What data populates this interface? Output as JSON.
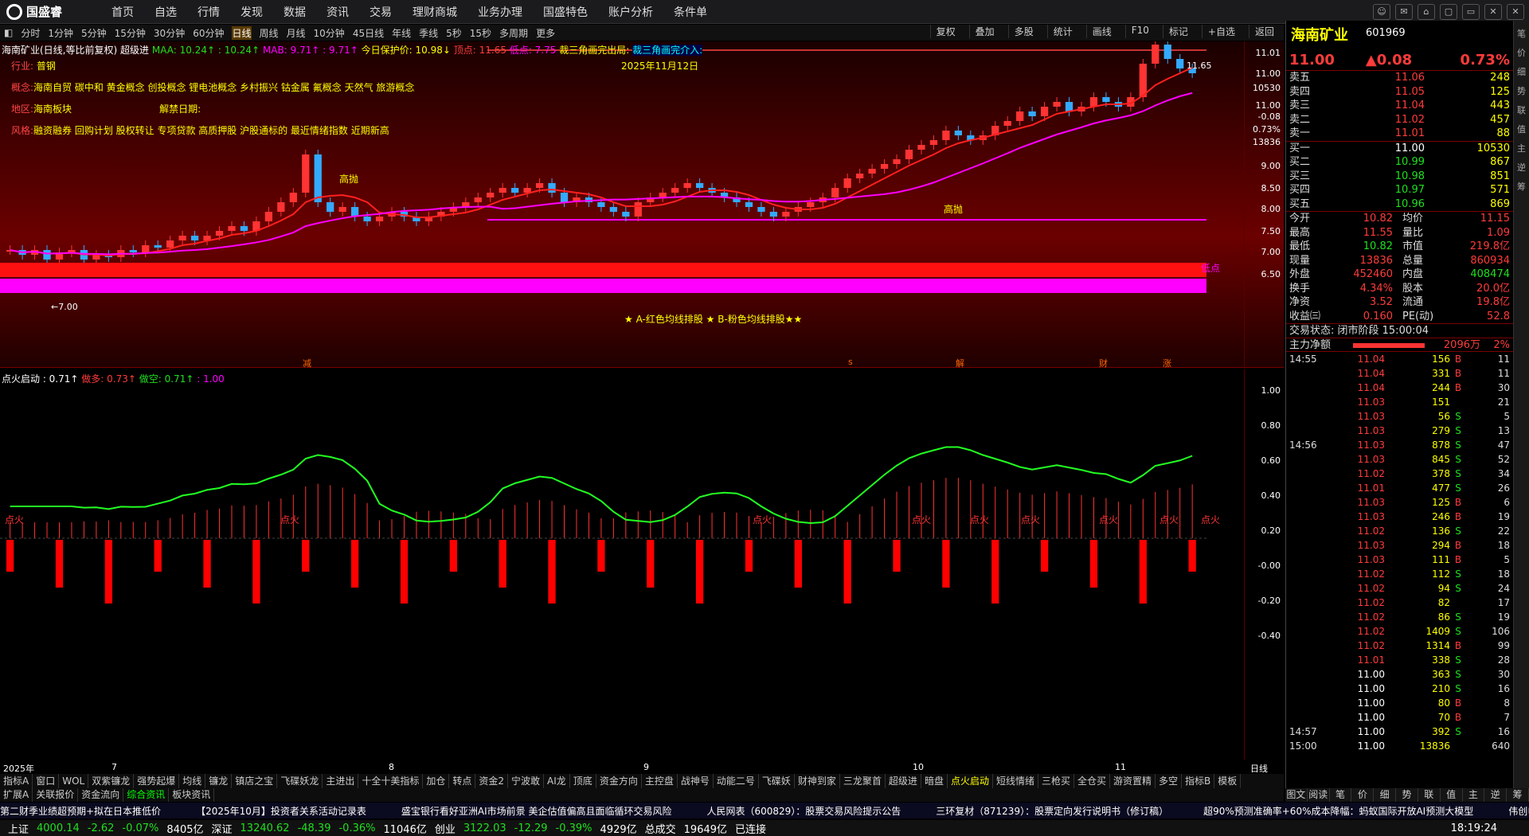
{
  "app": {
    "name": "国盛睿",
    "nav": [
      "首页",
      "自选",
      "行情",
      "发现",
      "数据",
      "资讯",
      "交易",
      "理财商城",
      "业务办理",
      "国盛特色",
      "账户分析",
      "条件单"
    ],
    "window_controls": [
      "☺",
      "✉",
      "⌂",
      "▢",
      "▭",
      "✕",
      "✕"
    ]
  },
  "periods": {
    "items": [
      "分时",
      "1分钟",
      "5分钟",
      "15分钟",
      "30分钟",
      "60分钟",
      "日线",
      "周线",
      "月线",
      "10分钟",
      "45日线",
      "年线",
      "季线",
      "5秒",
      "15秒",
      "多周期",
      "更多"
    ],
    "active": "日线"
  },
  "tools": [
    "复权",
    "叠加",
    "多股",
    "统计",
    "画线",
    "F10",
    "标记",
    "+自选",
    "返回"
  ],
  "main": {
    "title": "海南矿业(日线,等比前复权)",
    "title2": "超级进",
    "maa": "MAA: 10.24↑ : 10.24↑",
    "mab": "MAB: 9.71↑ : 9.71↑",
    "protect": "今日保护价: 10.98↓",
    "high": "顶点: 11.65",
    "low": "低点: 7.75",
    "tri1": "裁三角画完出局:",
    "tri2": "裁三角画完介入:",
    "industry_k": "行业:",
    "industry": "普钢",
    "concept_k": "概念:",
    "concept": "海南自贸 碳中和 黄金概念 创投概念 锂电池概念 乡村振兴 钴金属 氟概念 天然气 旅游概念",
    "region_k": "地区:",
    "region": "海南板块",
    "unlock_k": "解禁日期:",
    "style_k": "风格:",
    "style": "融资融券 回购计划 股权转让 专项贷款 高质押股 沪股通标的 最近情绪指数 近期新高",
    "date_label": "2025年11月12日",
    "label_top": "高抛",
    "label_top2": "高抛",
    "label_low": "低点",
    "label_min": "←7.00",
    "label_max": "11.65",
    "banner": "★ A-红色均线排股 ★ B-粉色均线排股★★",
    "yticks": [
      "11.01",
      "11.00",
      "10530",
      "11.00",
      "-0.08",
      "0.73%",
      "13836",
      "9.00",
      "8.50",
      "8.00",
      "7.50",
      "7.00",
      "6.50"
    ],
    "events": [
      "减",
      "s",
      "解",
      "财",
      "涨"
    ]
  },
  "sub": {
    "title": "点火启动 : 0.71↑",
    "t2": "做多: 0.73↑",
    "t3": "做空: 0.71↑",
    "t4": ": 1.00",
    "fire": "点火",
    "yticks": [
      "1.00",
      "0.80",
      "0.60",
      "0.40",
      "0.20",
      "-0.00",
      "-0.20",
      "-0.40"
    ],
    "xlabels": [
      "2025年",
      "7",
      "8",
      "9",
      "10",
      "11"
    ],
    "xright": "日线"
  },
  "chart_data": {
    "type": "candlestick",
    "title": "海南矿业(日线,等比前复权)",
    "ylim": [
      6.5,
      11.5
    ],
    "max": 11.65,
    "min": 7.0,
    "close": [
      7.3,
      7.2,
      7.3,
      7.1,
      7.25,
      7.3,
      7.1,
      7.2,
      7.15,
      7.3,
      7.25,
      7.4,
      7.35,
      7.5,
      7.6,
      7.5,
      7.6,
      7.7,
      7.8,
      7.7,
      7.9,
      8.1,
      8.3,
      8.5,
      9.3,
      8.3,
      8.1,
      8.2,
      8.0,
      7.9,
      8.0,
      8.1,
      8.0,
      7.9,
      8.0,
      8.1,
      8.2,
      8.3,
      8.4,
      8.5,
      8.6,
      8.5,
      8.6,
      8.7,
      8.5,
      8.3,
      8.4,
      8.3,
      8.2,
      8.1,
      8.0,
      8.3,
      8.4,
      8.5,
      8.6,
      8.7,
      8.6,
      8.5,
      8.4,
      8.3,
      8.2,
      8.1,
      8.0,
      8.1,
      8.2,
      8.3,
      8.4,
      8.6,
      8.8,
      8.9,
      9.0,
      9.1,
      9.2,
      9.4,
      9.5,
      9.6,
      9.8,
      9.7,
      9.6,
      9.7,
      9.9,
      10.0,
      10.2,
      10.1,
      10.3,
      10.4,
      10.2,
      10.3,
      10.5,
      10.4,
      10.3,
      10.5,
      11.2,
      11.6,
      11.3,
      11.1,
      11.0
    ]
  },
  "panel": {
    "name": "海南矿业",
    "code": "601969",
    "price": "11.00",
    "chg": "▲0.08",
    "pct": "0.73%",
    "asks": [
      [
        "卖五",
        "11.06",
        "248"
      ],
      [
        "卖四",
        "11.05",
        "125"
      ],
      [
        "卖三",
        "11.04",
        "443"
      ],
      [
        "卖二",
        "11.02",
        "457"
      ],
      [
        "卖一",
        "11.01",
        "88"
      ]
    ],
    "bids": [
      [
        "买一",
        "11.00",
        "10530"
      ],
      [
        "买二",
        "10.99",
        "867"
      ],
      [
        "买三",
        "10.98",
        "851"
      ],
      [
        "买四",
        "10.97",
        "571"
      ],
      [
        "买五",
        "10.96",
        "869"
      ]
    ],
    "stats": [
      [
        "今开",
        "10.82",
        "均价",
        "11.15"
      ],
      [
        "最高",
        "11.55",
        "量比",
        "1.09"
      ],
      [
        "最低",
        "10.82",
        "市值",
        "219.8亿"
      ],
      [
        "现量",
        "13836",
        "总量",
        "860934"
      ],
      [
        "外盘",
        "452460",
        "内盘",
        "408474"
      ],
      [
        "换手",
        "4.34%",
        "股本",
        "20.0亿"
      ],
      [
        "净资",
        "3.52",
        "流通",
        "19.8亿"
      ],
      [
        "收益㈢",
        "0.160",
        "PE(动)",
        "52.8"
      ]
    ],
    "trade_state": "交易状态: 闭市阶段 15:00:04",
    "main_net_k": "主力净额",
    "main_net": "2096万",
    "main_pct": "2%",
    "ticks": [
      [
        "14:55",
        "11.04",
        "156",
        "B",
        "11"
      ],
      [
        "",
        "11.04",
        "331",
        "B",
        "11"
      ],
      [
        "",
        "11.04",
        "244",
        "B",
        "30"
      ],
      [
        "",
        "11.03",
        "151",
        "",
        "21"
      ],
      [
        "",
        "11.03",
        "56",
        "S",
        "5"
      ],
      [
        "",
        "11.03",
        "279",
        "S",
        "13"
      ],
      [
        "14:56",
        "11.03",
        "878",
        "S",
        "47"
      ],
      [
        "",
        "11.03",
        "845",
        "S",
        "52"
      ],
      [
        "",
        "11.02",
        "378",
        "S",
        "34"
      ],
      [
        "",
        "11.01",
        "477",
        "S",
        "26"
      ],
      [
        "",
        "11.03",
        "125",
        "B",
        "6"
      ],
      [
        "",
        "11.03",
        "246",
        "B",
        "19"
      ],
      [
        "",
        "11.02",
        "136",
        "S",
        "22"
      ],
      [
        "",
        "11.03",
        "294",
        "B",
        "18"
      ],
      [
        "",
        "11.03",
        "111",
        "B",
        "5"
      ],
      [
        "",
        "11.02",
        "112",
        "S",
        "18"
      ],
      [
        "",
        "11.02",
        "94",
        "S",
        "24"
      ],
      [
        "",
        "11.02",
        "82",
        "",
        "17"
      ],
      [
        "",
        "11.02",
        "86",
        "S",
        "19"
      ],
      [
        "",
        "11.02",
        "1409",
        "S",
        "106"
      ],
      [
        "",
        "11.02",
        "1314",
        "B",
        "99"
      ],
      [
        "",
        "11.01",
        "338",
        "S",
        "28"
      ],
      [
        "",
        "11.00",
        "363",
        "S",
        "30"
      ],
      [
        "",
        "11.00",
        "210",
        "S",
        "16"
      ],
      [
        "",
        "11.00",
        "80",
        "B",
        "8"
      ],
      [
        "",
        "11.00",
        "70",
        "B",
        "7"
      ],
      [
        "14:57",
        "11.00",
        "392",
        "S",
        "16"
      ],
      [
        "15:00",
        "11.00",
        "13836",
        "",
        "640"
      ]
    ]
  },
  "side": [
    "笔",
    "价",
    "细",
    "势",
    "联",
    "值",
    "主",
    "逆",
    "筹"
  ],
  "tabs1": [
    "指标A",
    "窗口",
    "WOL",
    "双紫镰龙",
    "强势起爆",
    "均线",
    "镰龙",
    "镇店之宝",
    "飞碟妖龙",
    "主进出",
    "十全十美指标",
    "加仓",
    "转点",
    "资金2",
    "宁波敢",
    "AI龙",
    "顶底",
    "资金方向",
    "主控盘",
    "战神号",
    "动能二号",
    "飞碟妖",
    "财神到家",
    "三龙聚首",
    "超级进",
    "暗盘",
    "点火启动",
    "短线情绪",
    "三枪买",
    "全仓买",
    "游资置精",
    "多空",
    "指标B",
    "模板"
  ],
  "tabs1_active": "点火启动",
  "tabs2": [
    "扩展A",
    "关联报价",
    "资金流向",
    "综合资讯",
    "板块资讯"
  ],
  "tabs2_active": "综合资讯",
  "rptabs": [
    "图文F10",
    "阅读栏",
    "笔",
    "价",
    "细",
    "势",
    "联",
    "值",
    "主",
    "逆",
    "筹"
  ],
  "news": [
    "第二财季业绩超预期+拟在日本推低价",
    "【2025年10月】投资者关系活动记录表",
    "盛宝银行看好亚洲AI市场前景 美企估值偏高且面临循环交易风险",
    "人民网表（600829）：股票交易风险提示公告",
    "三环复材（871239）：股票定向发行说明书（修订稿）",
    "超90%预测准确率+60%成本降幅：蚂蚁国际开放AI预测大模型",
    "伟创电"
  ],
  "status": {
    "sh_k": "上证",
    "sh": "4000.14",
    "sh_c": "-2.62",
    "sh_p": "-0.07%",
    "sh_v": "8405亿",
    "sz_k": "深证",
    "sz": "13240.62",
    "sz_c": "-48.39",
    "sz_p": "-0.36%",
    "sz_v": "11046亿",
    "cy_k": "创业",
    "cy": "3122.03",
    "cy_c": "-12.29",
    "cy_p": "-0.39%",
    "cy_v": "4929亿",
    "tot_k": "总成交",
    "tot": "19649亿",
    "conn": "已连接",
    "time": "18:19:24"
  }
}
